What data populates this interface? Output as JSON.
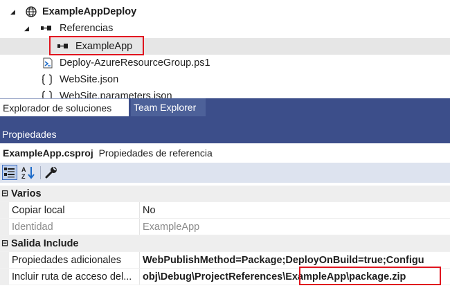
{
  "solution_tree": {
    "project_label": "ExampleAppDeploy",
    "references_label": "Referencias",
    "selected_reference_label": "ExampleApp",
    "files": [
      "Deploy-AzureResourceGroup.ps1",
      "WebSite.json",
      "WebSite.parameters.json"
    ]
  },
  "tabs": {
    "solution_explorer_label": "Explorador de soluciones",
    "team_explorer_label": "Team Explorer"
  },
  "properties": {
    "panel_title": "Propiedades",
    "object_name": "ExampleApp.csproj",
    "object_type": "Propiedades de referencia",
    "categories": [
      {
        "name": "Varios",
        "rows": [
          {
            "name": "Copiar local",
            "value": "No"
          },
          {
            "name": "Identidad",
            "value": "ExampleApp"
          }
        ]
      },
      {
        "name": "Salida Include",
        "rows": [
          {
            "name": "Propiedades adicionales",
            "value": "WebPublishMethod=Package;DeployOnBuild=true;Configu"
          },
          {
            "name": "Incluir ruta de acceso del...",
            "value_prefix": "obj\\Debug\\ProjectReferences",
            "value_highlight": "\\ExampleApp\\package.zip"
          }
        ]
      }
    ],
    "toggle_expanded_glyph": "⊟"
  },
  "icons": [
    "globe-project-icon",
    "reference-icon",
    "powershell-file-icon",
    "json-file-icon",
    "categorized-icon",
    "alphabetical-icon",
    "property-pages-icon"
  ],
  "colors": {
    "tab_strip": "#3c4e8a",
    "highlight_box": "#e0141e",
    "toolbar_bg": "#dde3ef",
    "selected_row": "#e6e6e6"
  }
}
